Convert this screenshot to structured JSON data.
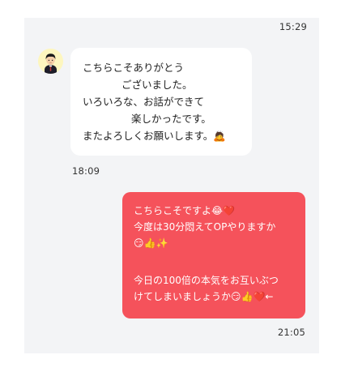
{
  "conversation": {
    "top_time": "15:29",
    "incoming": {
      "lines": [
        "こちらこそありがとう",
        "ございました。",
        "いろいろな、お話ができて",
        "楽しかったです。",
        "またよろしくお願いします。🙇"
      ],
      "time": "18:09"
    },
    "outgoing": {
      "lines": [
        "こちらこそですよ😂❤️",
        "今度は30分悶えてOPやりますか",
        "😏👍✨",
        "",
        "今日の100倍の本気をお互いぶつ",
        "けてしまいましょうか😏👍❤️←"
      ],
      "time": "21:05"
    }
  },
  "colors": {
    "chat_background": "#f3f4f6",
    "outgoing_bubble": "#f5525b",
    "incoming_bubble": "#ffffff",
    "avatar_background": "#fdf6bf"
  },
  "icons": {
    "avatar": "user-avatar-icon"
  }
}
